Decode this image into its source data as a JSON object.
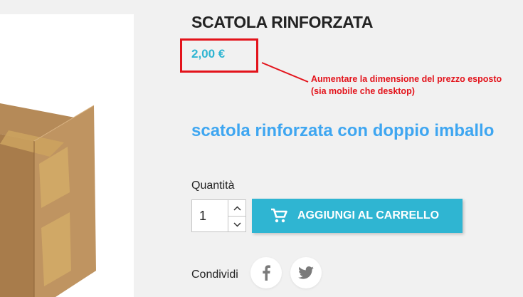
{
  "product": {
    "title": "SCATOLA RINFORZATA",
    "price": "2,00 €",
    "short_description": "scatola rinforzata con doppio imballo"
  },
  "annotation": {
    "text": "Aumentare la dimensione del prezzo esposto (sia mobile che desktop)",
    "color": "#e3131b"
  },
  "quantity": {
    "label": "Quantità",
    "value": "1"
  },
  "cart_button": {
    "label": "AGGIUNGI AL CARRELLO",
    "icon": "cart-icon",
    "color": "#2fb5d2"
  },
  "share": {
    "label": "Condividi",
    "networks": [
      "facebook-icon",
      "twitter-icon"
    ]
  },
  "colors": {
    "price": "#2fb5d2",
    "subtitle": "#3ea6f1",
    "background": "#f1f1f1"
  }
}
